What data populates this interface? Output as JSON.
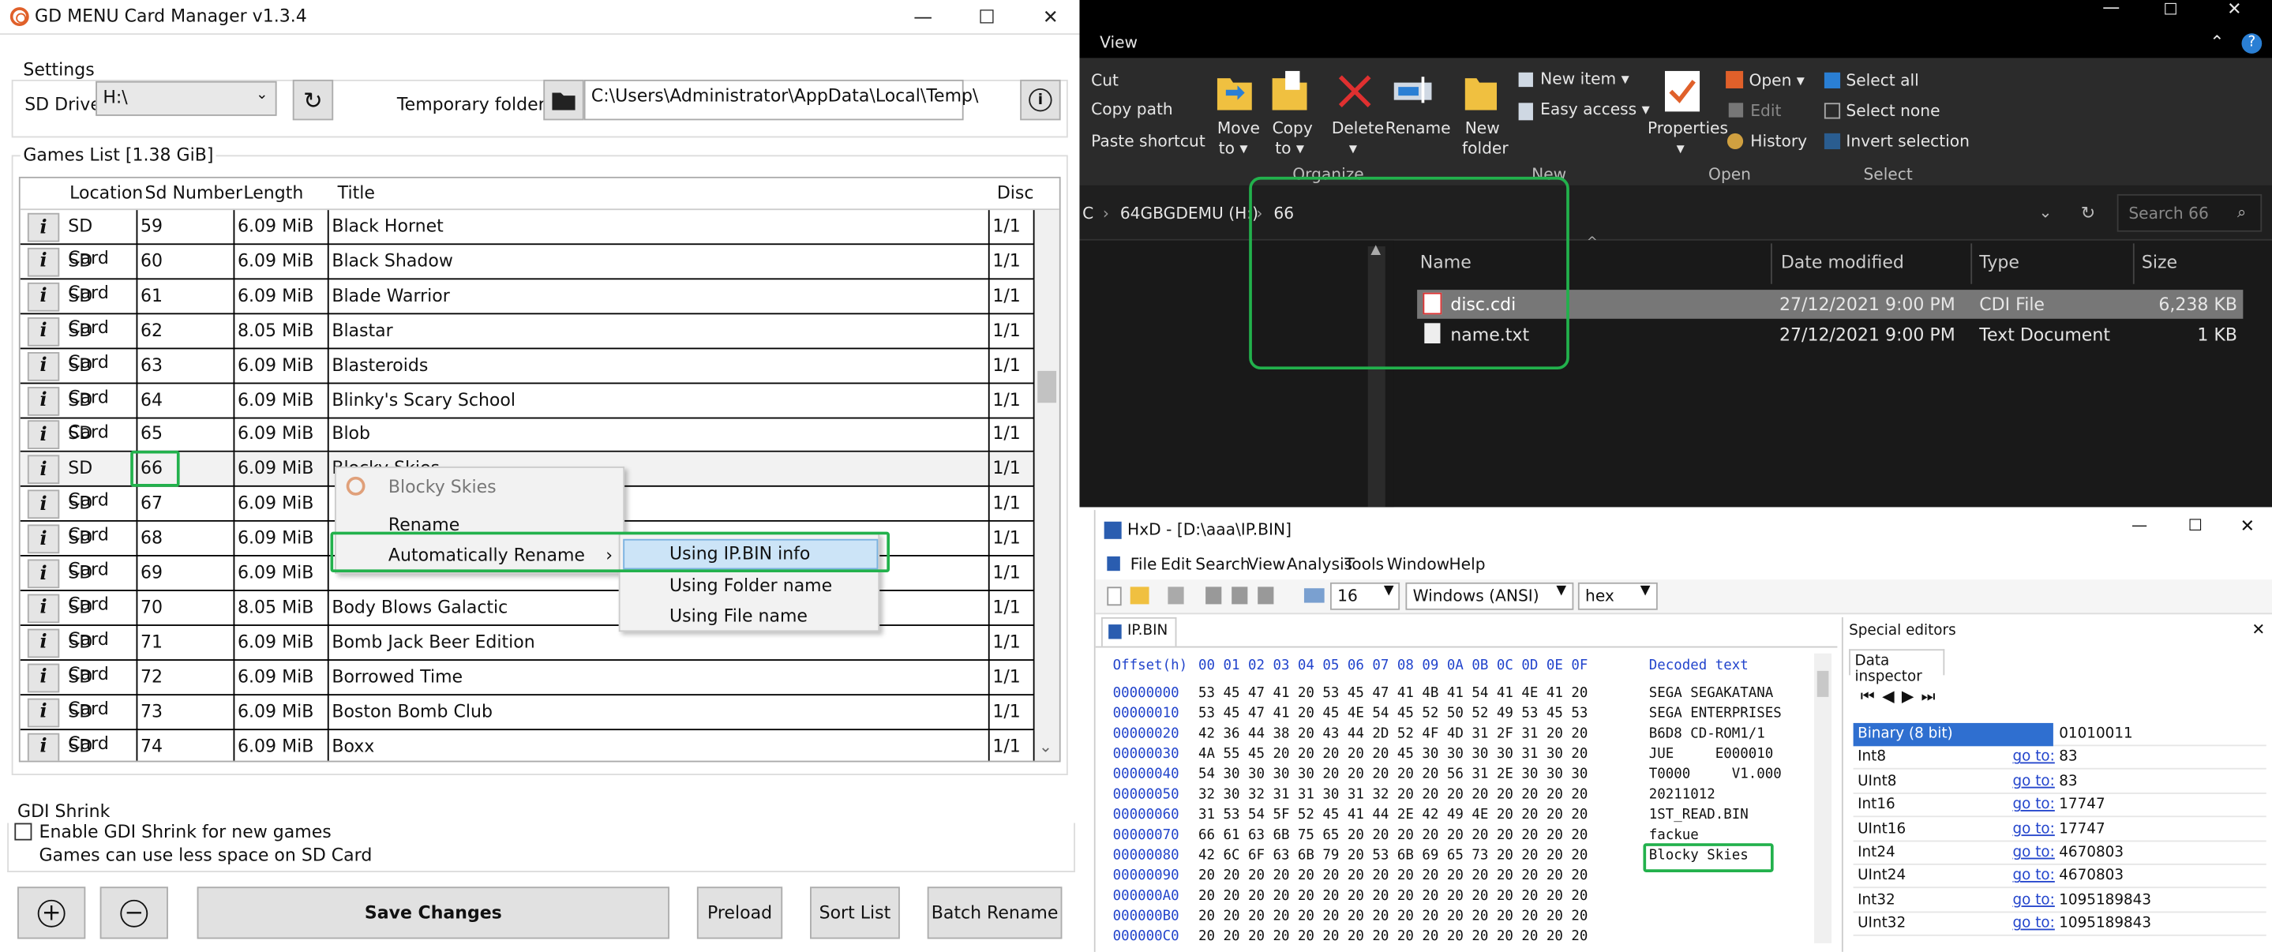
{
  "app": {
    "title": "GD MENU Card Manager v1.3.4",
    "settings_label": "Settings",
    "sd_drive_label": "SD Drive",
    "sd_drive_value": "H:\\",
    "temp_label": "Temporary folder",
    "temp_value": "C:\\Users\\Administrator\\AppData\\Local\\Temp\\",
    "games_list_label": "Games List [1.38 GiB]",
    "columns": [
      "Location",
      "Sd Number",
      "Length",
      "Title",
      "Disc"
    ],
    "rows": [
      [
        "SD Card",
        "59",
        "6.09 MiB",
        "Black Hornet",
        "1/1"
      ],
      [
        "SD Card",
        "60",
        "6.09 MiB",
        "Black Shadow",
        "1/1"
      ],
      [
        "SD Card",
        "61",
        "6.09 MiB",
        "Blade Warrior",
        "1/1"
      ],
      [
        "SD Card",
        "62",
        "8.05 MiB",
        "Blastar",
        "1/1"
      ],
      [
        "SD Card",
        "63",
        "6.09 MiB",
        "Blasteroids",
        "1/1"
      ],
      [
        "SD Card",
        "64",
        "6.09 MiB",
        "Blinky's Scary School",
        "1/1"
      ],
      [
        "SD Card",
        "65",
        "6.09 MiB",
        "Blob",
        "1/1"
      ],
      [
        "SD Card",
        "66",
        "6.09 MiB",
        "Blocky Skies",
        "1/1"
      ],
      [
        "SD Card",
        "67",
        "6.09 MiB",
        "",
        "1/1"
      ],
      [
        "SD Card",
        "68",
        "6.09 MiB",
        "",
        "1/1"
      ],
      [
        "SD Card",
        "69",
        "6.09 MiB",
        "",
        "1/1"
      ],
      [
        "SD Card",
        "70",
        "8.05 MiB",
        "Body Blows Galactic",
        "1/1"
      ],
      [
        "SD Card",
        "71",
        "6.09 MiB",
        "Bomb Jack Beer Edition",
        "1/1"
      ],
      [
        "SD Card",
        "72",
        "6.09 MiB",
        "Borrowed Time",
        "1/1"
      ],
      [
        "SD Card",
        "73",
        "6.09 MiB",
        "Boston Bomb Club",
        "1/1"
      ],
      [
        "SD Card",
        "74",
        "6.09 MiB",
        "Boxx",
        "1/1"
      ]
    ],
    "info_glyph": "i",
    "context_menu": {
      "header": "Blocky Skies",
      "rename": "Rename",
      "auto_rename": "Automatically Rename",
      "arrow": "›"
    },
    "submenu": [
      "Using IP.BIN info",
      "Using Folder name",
      "Using File name"
    ],
    "gdi_label": "GDI Shrink",
    "gdi_checkbox": "Enable GDI Shrink for new games",
    "gdi_note": "Games can use less space on SD Card",
    "buttons": {
      "save": "Save Changes",
      "preload": "Preload",
      "sort": "Sort List",
      "batch": "Batch Rename"
    },
    "win_min": "—",
    "win_max": "☐",
    "win_close": "✕"
  },
  "explorer": {
    "view_tab": "View",
    "clipboard": {
      "cut": "Cut",
      "copy_path": "Copy path",
      "paste_shortcut": "Paste shortcut"
    },
    "organize": {
      "move": "Move",
      "move2": "to ▾",
      "copy": "Copy",
      "copy2": "to ▾",
      "delete": "Delete",
      "delete2": "▾",
      "rename": "Rename",
      "label": "Organize"
    },
    "new": {
      "folder": "New",
      "folder2": "folder",
      "item": "New item ▾",
      "easy": "Easy access ▾",
      "label": "New"
    },
    "open": {
      "properties": "Properties",
      "properties2": "▾",
      "open": "Open ▾",
      "edit": "Edit",
      "history": "History",
      "label": "Open"
    },
    "select": {
      "all": "Select all",
      "none": "Select none",
      "invert": "Invert selection",
      "label": "Select"
    },
    "path": [
      "C",
      "64GBGDEMU (H:)",
      "66"
    ],
    "search": "Search 66",
    "columns": [
      "Name",
      "Date modified",
      "Type",
      "Size"
    ],
    "files": [
      {
        "name": "disc.cdi",
        "date": "27/12/2021 9:00 PM",
        "type": "CDI File",
        "size": "6,238 KB"
      },
      {
        "name": "name.txt",
        "date": "27/12/2021 9:00 PM",
        "type": "Text Document",
        "size": "1 KB"
      }
    ]
  },
  "hxd": {
    "title": "HxD  - [D:\\aaa\\IP.BIN]",
    "menu": [
      "File",
      "Edit",
      "Search",
      "View",
      "Analysis",
      "Tools",
      "Window",
      "Help"
    ],
    "bytes_per_row": "16",
    "encoding": "Windows (ANSI)",
    "mode": "hex",
    "tab": "IP.BIN",
    "header_offset": "Offset(h)",
    "header_cols": "00 01 02 03 04 05 06 07 08 09 0A 0B 0C 0D 0E 0F",
    "header_decoded": "Decoded text",
    "rows": [
      {
        "off": "00000000",
        "hex": "53 45 47 41 20 53 45 47 41 4B 41 54 41 4E 41 20",
        "txt": "SEGA SEGAKATANA"
      },
      {
        "off": "00000010",
        "hex": "53 45 47 41 20 45 4E 54 45 52 50 52 49 53 45 53",
        "txt": "SEGA ENTERPRISES"
      },
      {
        "off": "00000020",
        "hex": "42 36 44 38 20 43 44 2D 52 4F 4D 31 2F 31 20 20",
        "txt": "B6D8 CD-ROM1/1"
      },
      {
        "off": "00000030",
        "hex": "4A 55 45 20 20 20 20 20 45 30 30 30 30 31 30 20",
        "txt": "JUE     E000010"
      },
      {
        "off": "00000040",
        "hex": "54 30 30 30 30 20 20 20 20 20 56 31 2E 30 30 30",
        "txt": "T0000     V1.000"
      },
      {
        "off": "00000050",
        "hex": "32 30 32 31 31 30 31 32 20 20 20 20 20 20 20 20",
        "txt": "20211012"
      },
      {
        "off": "00000060",
        "hex": "31 53 54 5F 52 45 41 44 2E 42 49 4E 20 20 20 20",
        "txt": "1ST_READ.BIN"
      },
      {
        "off": "00000070",
        "hex": "66 61 63 6B 75 65 20 20 20 20 20 20 20 20 20 20",
        "txt": "fackue"
      },
      {
        "off": "00000080",
        "hex": "42 6C 6F 63 6B 79 20 53 6B 69 65 73 20 20 20 20",
        "txt": "Blocky Skies"
      },
      {
        "off": "00000090",
        "hex": "20 20 20 20 20 20 20 20 20 20 20 20 20 20 20 20",
        "txt": ""
      },
      {
        "off": "000000A0",
        "hex": "20 20 20 20 20 20 20 20 20 20 20 20 20 20 20 20",
        "txt": ""
      },
      {
        "off": "000000B0",
        "hex": "20 20 20 20 20 20 20 20 20 20 20 20 20 20 20 20",
        "txt": ""
      },
      {
        "off": "000000C0",
        "hex": "20 20 20 20 20 20 20 20 20 20 20 20 20 20 20 20",
        "txt": ""
      }
    ],
    "special_editors": "Special editors",
    "data_inspector": "Data inspector",
    "goto": "go to:",
    "inspector": [
      {
        "label": "Binary (8 bit)",
        "value": "01010011",
        "goto": false
      },
      {
        "label": "Int8",
        "value": "83",
        "goto": true
      },
      {
        "label": "UInt8",
        "value": "83",
        "goto": true
      },
      {
        "label": "Int16",
        "value": "17747",
        "goto": true
      },
      {
        "label": "UInt16",
        "value": "17747",
        "goto": true
      },
      {
        "label": "Int24",
        "value": "4670803",
        "goto": true
      },
      {
        "label": "UInt24",
        "value": "4670803",
        "goto": true
      },
      {
        "label": "Int32",
        "value": "1095189843",
        "goto": true
      },
      {
        "label": "UInt32",
        "value": "1095189843",
        "goto": true
      }
    ]
  }
}
